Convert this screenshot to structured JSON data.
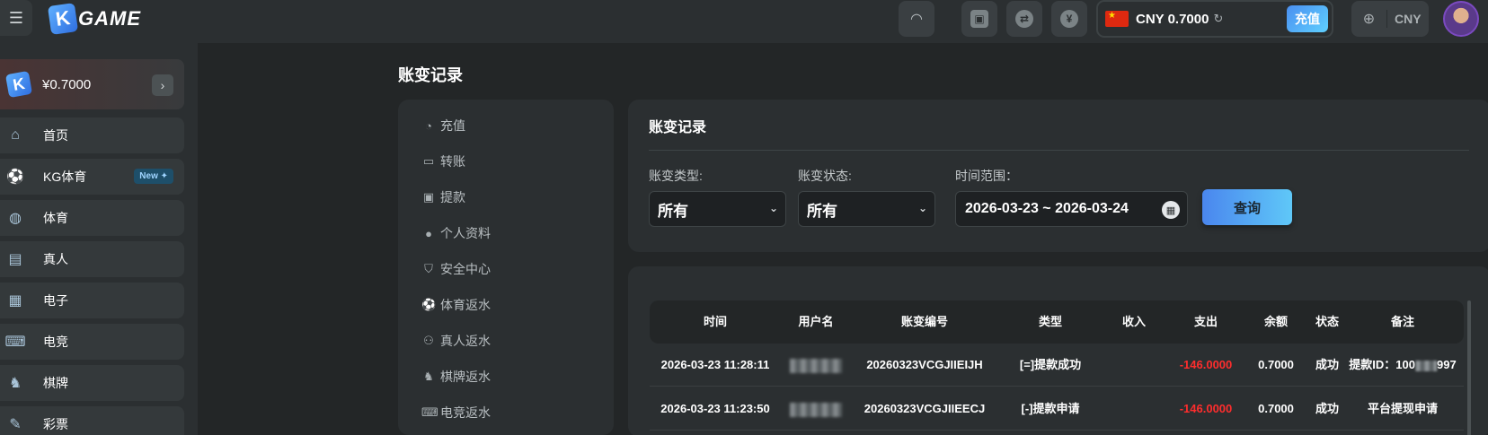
{
  "header": {
    "logo_letter": "K",
    "logo_text": "GAME",
    "currency_code": "CNY",
    "currency_value": "CNY 0.7000",
    "recharge_label": "充值",
    "language_label": "CNY",
    "icons": [
      "menu-icon",
      "signal-icon",
      "wallet-icon",
      "swap-icon",
      "vip-icon",
      "refresh-icon",
      "globe-icon"
    ]
  },
  "sidebar": {
    "wallet_amount": "¥0.7000",
    "items": [
      {
        "label": "首页",
        "icon": "home-icon"
      },
      {
        "label": "KG体育",
        "icon": "soccer-icon",
        "badge": "New ✦"
      },
      {
        "label": "体育",
        "icon": "basketball-icon"
      },
      {
        "label": "真人",
        "icon": "cards-icon"
      },
      {
        "label": "电子",
        "icon": "slot-icon"
      },
      {
        "label": "电竞",
        "icon": "gamepad-icon"
      },
      {
        "label": "棋牌",
        "icon": "chess-icon"
      },
      {
        "label": "彩票",
        "icon": "ticket-icon"
      }
    ]
  },
  "main": {
    "page_title": "账变记录",
    "sub_menu": [
      {
        "label": "充值",
        "icon": "piggy-icon"
      },
      {
        "label": "转账",
        "icon": "transfer-icon"
      },
      {
        "label": "提款",
        "icon": "withdraw-icon"
      },
      {
        "label": "个人资料",
        "icon": "user-icon"
      },
      {
        "label": "安全中心",
        "icon": "shield-icon"
      },
      {
        "label": "体育返水",
        "icon": "soccer-icon"
      },
      {
        "label": "真人返水",
        "icon": "people-icon"
      },
      {
        "label": "棋牌返水",
        "icon": "chess-icon"
      },
      {
        "label": "电竞返水",
        "icon": "gamepad-icon"
      }
    ],
    "filter": {
      "title": "账变记录",
      "type_label": "账变类型:",
      "type_value": "所有",
      "status_label": "账变状态:",
      "status_value": "所有",
      "range_label": "时间范围：",
      "range_value": "2026-03-23 ~ 2026-03-24",
      "query_label": "查询"
    },
    "table": {
      "headers": [
        "时间",
        "用户名",
        "账变编号",
        "类型",
        "收入",
        "支出",
        "余额",
        "状态",
        "备注"
      ],
      "rows": [
        {
          "time": "2026-03-23 11:28:11",
          "order": "20260323VCGJIIEIJH",
          "type": "[=]提款成功",
          "income": "",
          "expense": "-146.0000",
          "balance": "0.7000",
          "status": "成功",
          "note_prefix": "提款ID：100",
          "note_suffix": "997"
        },
        {
          "time": "2026-03-23 11:23:50",
          "order": "20260323VCGJIIEECJ",
          "type": "[-]提款申请",
          "income": "",
          "expense": "-146.0000",
          "balance": "0.7000",
          "status": "成功",
          "note_prefix": "平台提现申请",
          "note_suffix": ""
        }
      ]
    }
  },
  "colors": {
    "accent": "#4a86ee",
    "negative": "#ff2d2d",
    "background": "#232627",
    "panel": "#2b2f31"
  }
}
